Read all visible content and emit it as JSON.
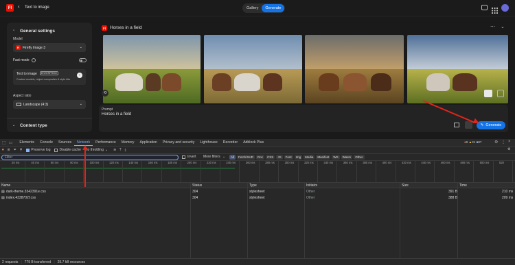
{
  "topbar": {
    "back_label": "Text to image",
    "tabs": [
      {
        "label": "Gallery"
      },
      {
        "label": "Generate"
      }
    ]
  },
  "left_panel": {
    "section_title": "General settings",
    "model_label": "Model",
    "model_value": "Firefly Image 3",
    "fast_mode_label": "Fast mode",
    "tti_label": "Text to image",
    "tti_badge": "ENTERPRISE",
    "tti_desc": "Custom models, object composites & style kits",
    "aspect_label": "Aspect ratio",
    "aspect_value": "Landscape (4:3)",
    "content_type_label": "Content type"
  },
  "main": {
    "logo_text": "Fl",
    "prompt_title": "Horses in a field",
    "prompt_label": "Prompt",
    "prompt_value": "Horses in a field",
    "generate_label": "Generate"
  },
  "devtools": {
    "tabs": [
      "Elements",
      "Console",
      "Sources",
      "Network",
      "Performance",
      "Memory",
      "Application",
      "Privacy and security",
      "Lighthouse",
      "Recorder",
      "Adblock Plus"
    ],
    "errors": "8",
    "warnings": "31",
    "info": "87",
    "toolbar": {
      "preserve_log": "Preserve log",
      "disable_cache": "Disable cache",
      "throttle": "No throttling"
    },
    "filter_placeholder": "Filter",
    "invert": "Invert",
    "more_filters": "More filters",
    "chips": [
      "All",
      "Fetch/XHR",
      "Doc",
      "CSS",
      "JS",
      "Font",
      "Img",
      "Media",
      "Manifest",
      "WS",
      "Wasm",
      "Other"
    ],
    "ticks": [
      "20 ms",
      "40 ms",
      "60 ms",
      "80 ms",
      "100 ms",
      "120 ms",
      "140 ms",
      "160 ms",
      "180 ms",
      "200 ms",
      "220 ms",
      "240 ms",
      "260 ms",
      "280 ms",
      "300 ms",
      "320 ms",
      "340 ms",
      "360 ms",
      "380 ms",
      "400 ms",
      "420 ms",
      "440 ms",
      "460 ms",
      "480 ms",
      "500 ms",
      "520"
    ],
    "columns": [
      "Name",
      "Status",
      "Type",
      "Initiator",
      "Size",
      "Time"
    ],
    "rows": [
      {
        "name": "dark-theme.3342391e.css",
        "status": "304",
        "type": "stylesheet",
        "initiator": "Other",
        "size": "391 B",
        "time": "210 ms"
      },
      {
        "name": "index.4338702f.css",
        "status": "304",
        "type": "stylesheet",
        "initiator": "Other",
        "size": "388 B",
        "time": "209 ms"
      }
    ],
    "status_bar": {
      "requests": "2 requests",
      "transferred": "779 B transferred",
      "resources": "29.7 kB resources"
    }
  },
  "colors": {
    "accent": "#1473e6",
    "brand": "#eb1000",
    "annotation": "#e0251b"
  }
}
